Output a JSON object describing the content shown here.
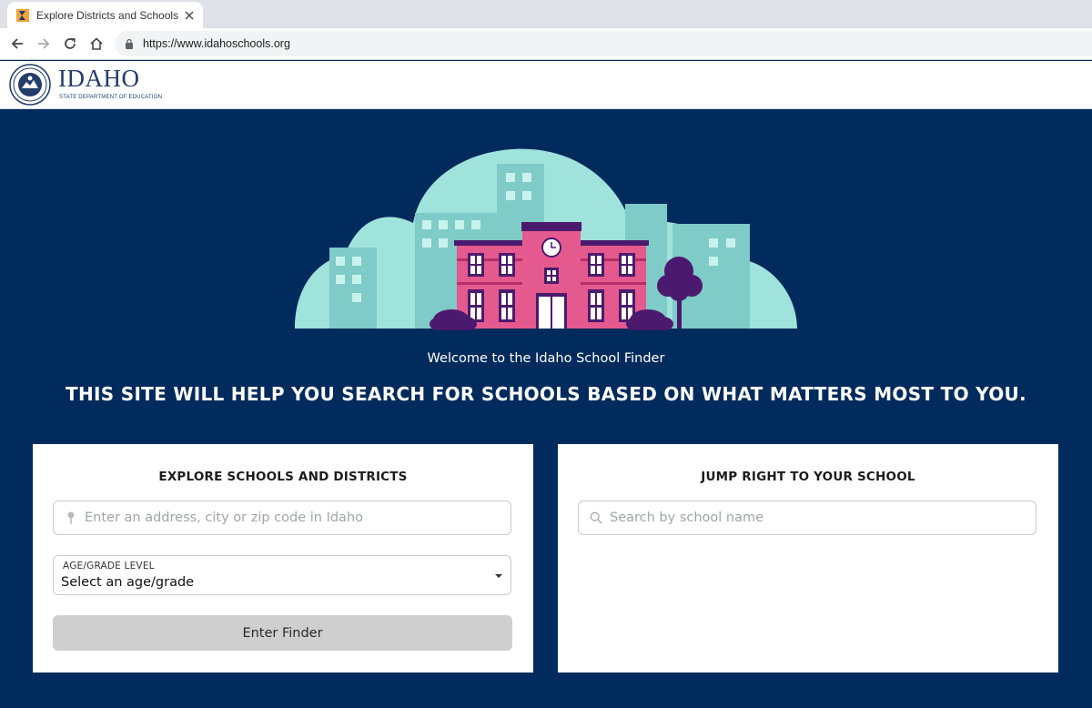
{
  "browser": {
    "tab_title": "Explore Districts and Schools",
    "url": "https://www.idahoschools.org"
  },
  "header": {
    "brand_name": "IDAHO",
    "brand_subtitle": "STATE DEPARTMENT OF EDUCATION"
  },
  "hero": {
    "welcome": "Welcome to the Idaho School Finder",
    "headline": "THIS SITE WILL HELP YOU SEARCH FOR SCHOOLS BASED ON WHAT MATTERS MOST TO YOU."
  },
  "explore_card": {
    "title": "EXPLORE SCHOOLS AND DISTRICTS",
    "address_placeholder": "Enter an address, city or zip code in Idaho",
    "grade_label": "AGE/GRADE LEVEL",
    "grade_value": "Select an age/grade",
    "button_label": "Enter Finder"
  },
  "jump_card": {
    "title": "JUMP RIGHT TO YOUR SCHOOL",
    "search_placeholder": "Search by school name"
  },
  "colors": {
    "hero_background": "#012b5c",
    "illustration_mint": "#9fe3dc",
    "school_pink": "#e55a8e",
    "accent_purple": "#4b1a6e",
    "button_gray": "#cfcfcf"
  }
}
